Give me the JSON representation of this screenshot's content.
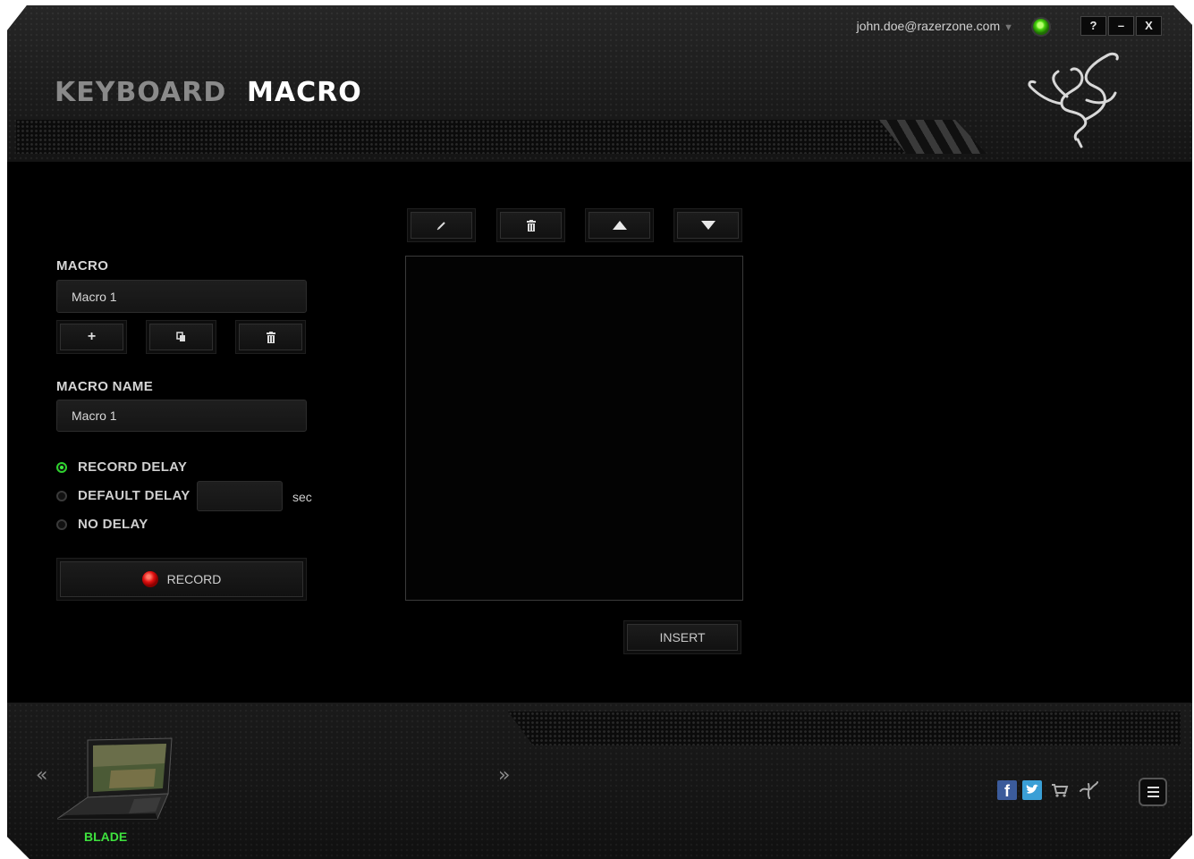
{
  "header": {
    "tabs": [
      {
        "label": "KEYBOARD",
        "active": false
      },
      {
        "label": "MACRO",
        "active": true
      }
    ],
    "account_email": "john.doe@razerzone.com",
    "account_arrow": "▼",
    "status_color": "#44d10a",
    "window_buttons": {
      "help": "?",
      "minimize": "–",
      "close": "X"
    },
    "logo_icon": "razer-snake-logo"
  },
  "macro_panel": {
    "macro_label": "MACRO",
    "macro_value": "Macro 1",
    "actions": {
      "add": "+",
      "copy_icon": "copy-icon",
      "delete_icon": "trash-icon"
    },
    "name_label": "MACRO NAME",
    "name_value": "Macro 1",
    "delay_options": [
      {
        "label": "RECORD DELAY",
        "selected": true
      },
      {
        "label": "DEFAULT DELAY",
        "selected": false
      },
      {
        "label": "NO DELAY",
        "selected": false
      }
    ],
    "default_delay_value": "",
    "delay_unit": "sec",
    "record_label": "RECORD",
    "record_icon_color": "#e01010"
  },
  "editor": {
    "toolbar_icons": [
      "edit-icon",
      "trash-icon",
      "move-up-icon",
      "move-down-icon"
    ],
    "insert_label": "INSERT"
  },
  "footer": {
    "prev_arrow": "«",
    "next_arrow": "»",
    "device_name": "BLADE",
    "social_icons": [
      "facebook-icon",
      "twitter-icon",
      "store-cart-icon",
      "razer-icon"
    ],
    "accent_color": "#3ee23e"
  }
}
